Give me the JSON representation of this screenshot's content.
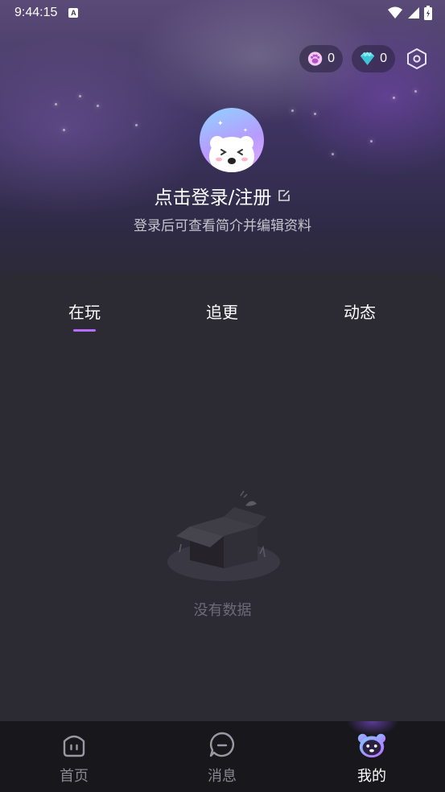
{
  "status_bar": {
    "time": "9:44:15",
    "notif_letter": "A"
  },
  "header": {
    "paw_count": "0",
    "diamond_count": "0"
  },
  "profile": {
    "login_label": "点击登录/注册",
    "subtitle": "登录后可查看简介并编辑资料"
  },
  "tabs": [
    {
      "label": "在玩",
      "active": true
    },
    {
      "label": "追更",
      "active": false
    },
    {
      "label": "动态",
      "active": false
    }
  ],
  "empty_state": {
    "text": "没有数据"
  },
  "bottom_nav": [
    {
      "label": "首页",
      "icon": "home-icon",
      "active": false
    },
    {
      "label": "消息",
      "icon": "message-icon",
      "active": false
    },
    {
      "label": "我的",
      "icon": "bear-profile-icon",
      "active": true
    }
  ],
  "colors": {
    "accent": "#b46dff",
    "panel": "#2c2a33",
    "nav_bg": "#18171c"
  }
}
